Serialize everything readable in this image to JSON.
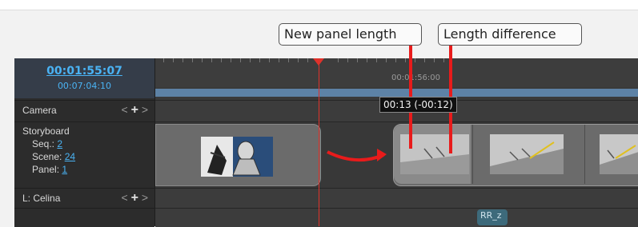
{
  "header": {
    "current_time": "00:01:55:07",
    "total_time": "00:07:04:10"
  },
  "tracks": {
    "camera": "Camera",
    "storyboard": "Storyboard",
    "seq_label": "Seq.:",
    "seq_value": "2",
    "scene_label": "Scene:",
    "scene_value": "24",
    "panel_label": "Panel:",
    "panel_value": "1",
    "layer": "L: Celina"
  },
  "ruler": {
    "label": "00:01:56:00"
  },
  "tooltip": {
    "text": "00:13 (-00:12)"
  },
  "callouts": {
    "new_panel_length": "New panel length",
    "length_difference": "Length difference"
  },
  "badge": {
    "text": "RR_z"
  },
  "colors": {
    "accent": "#4ab3f4",
    "playhead": "#e0322b",
    "annotation": "#e81b1b"
  },
  "icons": [
    "nav-left-icon",
    "add-icon",
    "nav-right-icon"
  ]
}
